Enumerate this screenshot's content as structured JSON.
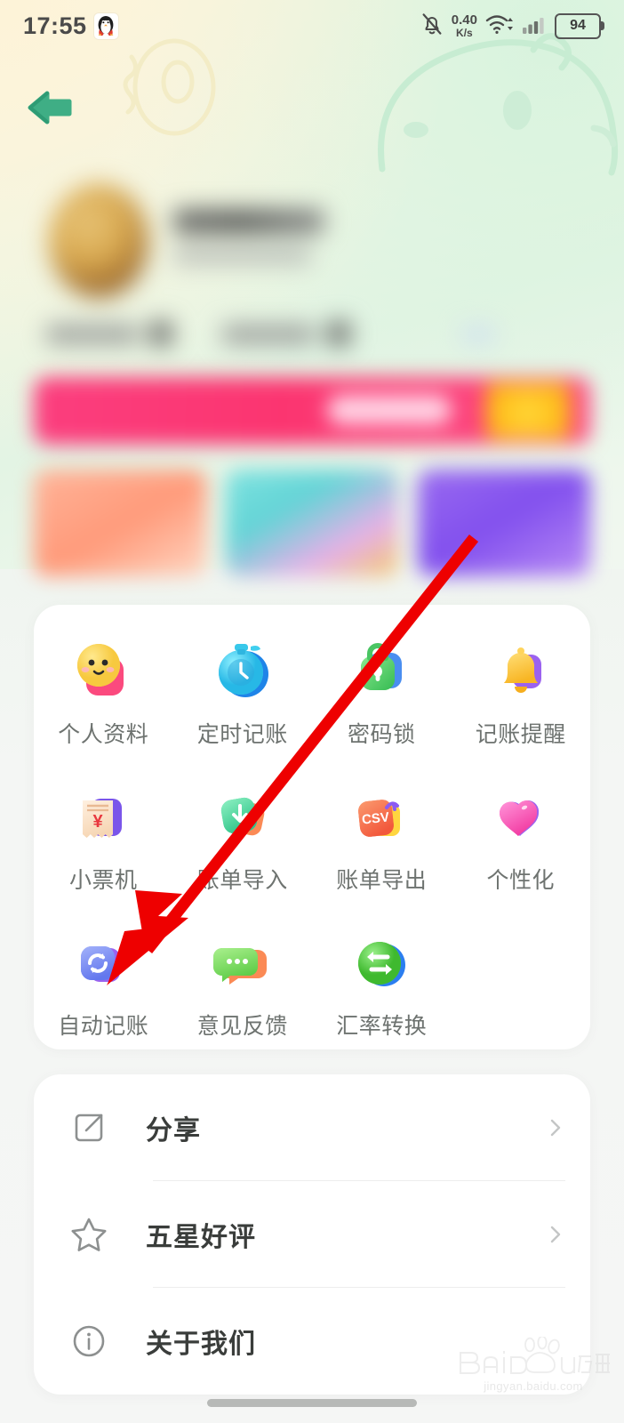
{
  "statusbar": {
    "time": "17:55",
    "qq_icon": "qq-penguin-icon",
    "mute_icon": "bell-muted-icon",
    "net_speed": "0.40",
    "net_speed_unit": "K/s",
    "wifi_icon": "wifi-icon",
    "signal_icon": "cellular-signal-icon",
    "battery_level": "94"
  },
  "header": {
    "back_icon": "back-arrow-icon"
  },
  "grid": {
    "items": [
      {
        "label": "个人资料",
        "icon": "smiley-face-icon"
      },
      {
        "label": "定时记账",
        "icon": "stopwatch-icon"
      },
      {
        "label": "密码锁",
        "icon": "padlock-icon"
      },
      {
        "label": "记账提醒",
        "icon": "bell-icon"
      },
      {
        "label": "小票机",
        "icon": "receipt-printer-icon"
      },
      {
        "label": "账单导入",
        "icon": "import-icon"
      },
      {
        "label": "账单导出",
        "icon": "csv-export-icon"
      },
      {
        "label": "个性化",
        "icon": "heart-icon"
      },
      {
        "label": "自动记账",
        "icon": "auto-sync-icon"
      },
      {
        "label": "意见反馈",
        "icon": "feedback-bubble-icon"
      },
      {
        "label": "汇率转换",
        "icon": "exchange-icon"
      }
    ]
  },
  "list": {
    "items": [
      {
        "label": "分享",
        "icon": "share-external-icon",
        "chevron": "chevron-right-icon"
      },
      {
        "label": "五星好评",
        "icon": "star-icon",
        "chevron": "chevron-right-icon"
      },
      {
        "label": "关于我们",
        "icon": "info-icon",
        "chevron": "chevron-right-icon"
      }
    ]
  },
  "annotation": {
    "arrow_color": "#ee0000",
    "target_label": "自动记账"
  },
  "watermark": {
    "brand": "Baidu",
    "suffix": "经验",
    "url": "jingyan.baidu.com"
  },
  "colors": {
    "accent_green": "#3fae85",
    "bg_top": "#fdf6e0",
    "bg_mid": "#e3f4e4",
    "card_bg": "#ffffff",
    "label_gray": "#6e7370",
    "title_dark": "#3a3d3b"
  }
}
